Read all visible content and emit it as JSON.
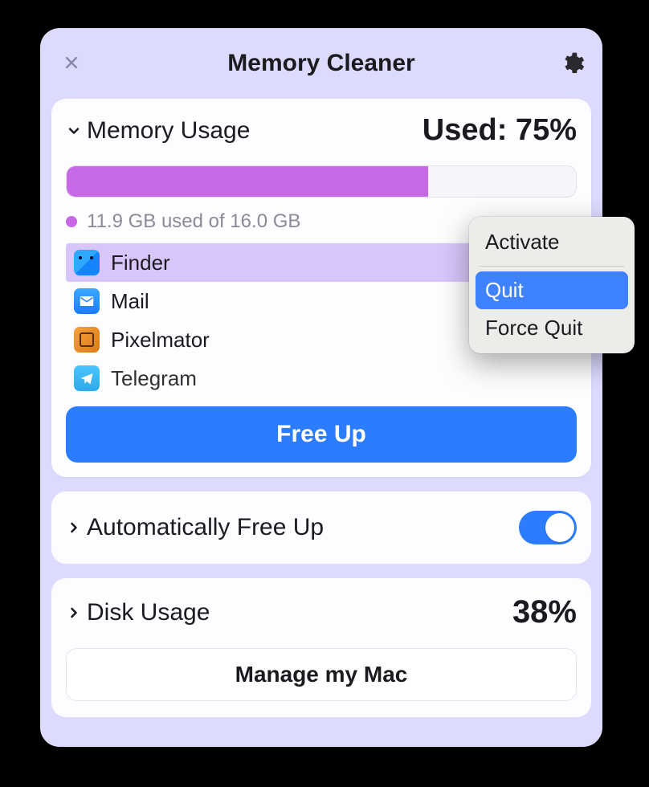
{
  "window": {
    "title": "Memory Cleaner"
  },
  "memory": {
    "section_title": "Memory Usage",
    "used_label": "Used: 75%",
    "progress_percent": 71,
    "usage_text": "11.9 GB used of 16.0 GB",
    "apps": [
      {
        "name": "Finder",
        "icon": "finder",
        "selected": true
      },
      {
        "name": "Mail",
        "icon": "mail",
        "selected": false
      },
      {
        "name": "Pixelmator",
        "icon": "pixelmator",
        "selected": false
      },
      {
        "name": "Telegram",
        "icon": "telegram",
        "selected": false
      }
    ],
    "free_up_label": "Free Up"
  },
  "auto": {
    "label": "Automatically Free Up",
    "enabled": true
  },
  "disk": {
    "section_title": "Disk Usage",
    "percent_label": "38%",
    "manage_label": "Manage my Mac"
  },
  "context_menu": {
    "items": [
      {
        "label": "Activate",
        "highlight": false
      },
      {
        "label": "Quit",
        "highlight": true
      },
      {
        "label": "Force Quit",
        "highlight": false
      }
    ]
  },
  "colors": {
    "accent": "#2b7cff",
    "progress": "#c768e6",
    "panel": "#dcdbff"
  }
}
